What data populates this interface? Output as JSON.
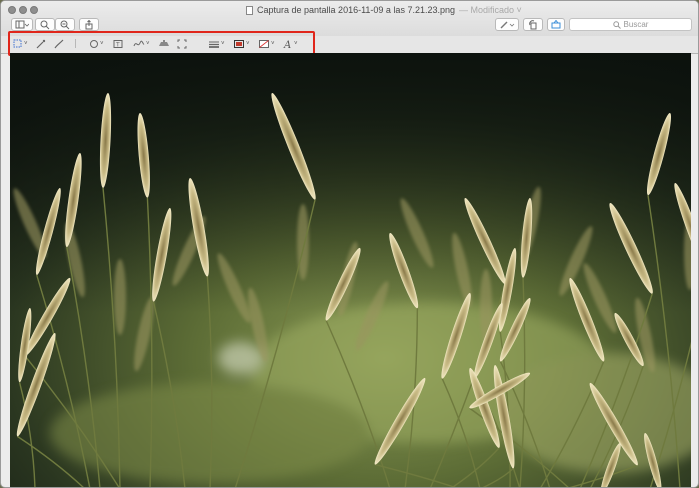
{
  "window": {
    "title": "Captura de pantalla 2016-11-09 a las 7.21.23.png",
    "status": "— Modificado ˅"
  },
  "toolbar": {
    "sidebar_icon": "sidebar-icon",
    "zoom_out_icon": "zoom-out-icon",
    "zoom_in_icon": "zoom-in-icon",
    "share_icon": "share-icon",
    "pen_icon": "markup-pen-icon",
    "rotate_icon": "rotate-icon",
    "annotate_icon": "annotate-icon",
    "search_placeholder": "Buscar"
  },
  "markup_toolbar": {
    "tools": [
      "rect-selection-icon",
      "instant-alpha-icon",
      "sketch-icon",
      "shapes-icon",
      "text-icon",
      "sign-icon",
      "adjust-color-icon",
      "adjust-size-icon",
      "shape-style-icon",
      "border-color-icon",
      "fill-color-icon",
      "text-style-icon"
    ],
    "highlight_color": "#e0261b",
    "border_color_swatch": "#c0392b"
  },
  "image": {
    "subject": "photo"
  }
}
